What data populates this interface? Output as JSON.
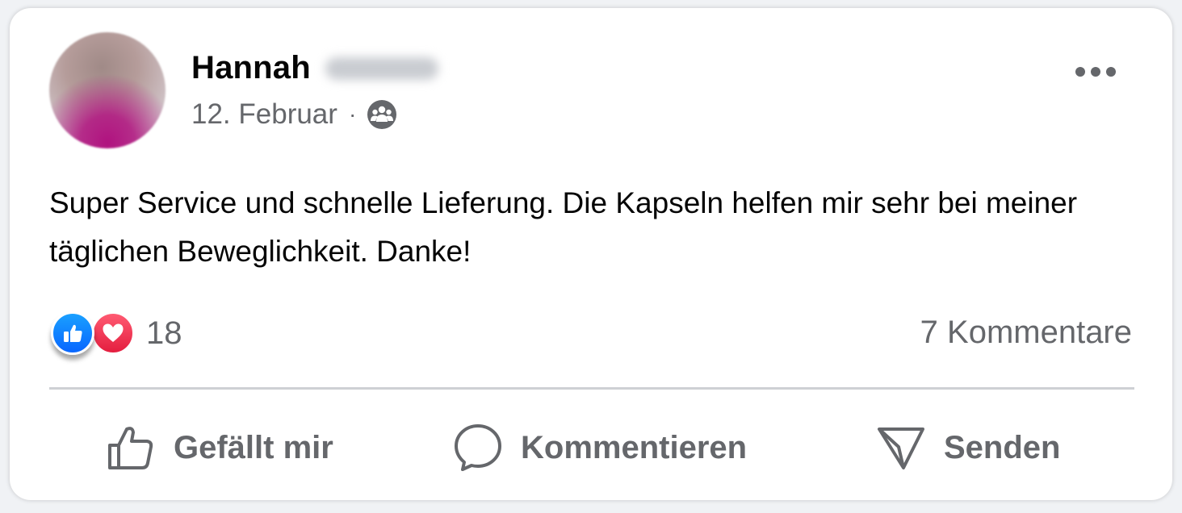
{
  "post": {
    "author_first_name": "Hannah",
    "date": "12. Februar",
    "separator": "·",
    "audience_icon": "group-icon",
    "text": "Super Service und schnelle Lieferung. Die Kapseln helfen mir sehr bei meiner täglichen Beweglichkeit. Danke!"
  },
  "reactions": {
    "icons": [
      "like-reaction-icon",
      "love-reaction-icon"
    ],
    "count": "18"
  },
  "comments": {
    "count_label": "7 Kommentare"
  },
  "actions": {
    "like_label": "Gefällt mir",
    "comment_label": "Kommentieren",
    "send_label": "Senden"
  },
  "colors": {
    "like_blue": "#0866ff",
    "love_red": "#e41e3f",
    "secondary_text": "#65676b",
    "primary_text": "#050505"
  }
}
